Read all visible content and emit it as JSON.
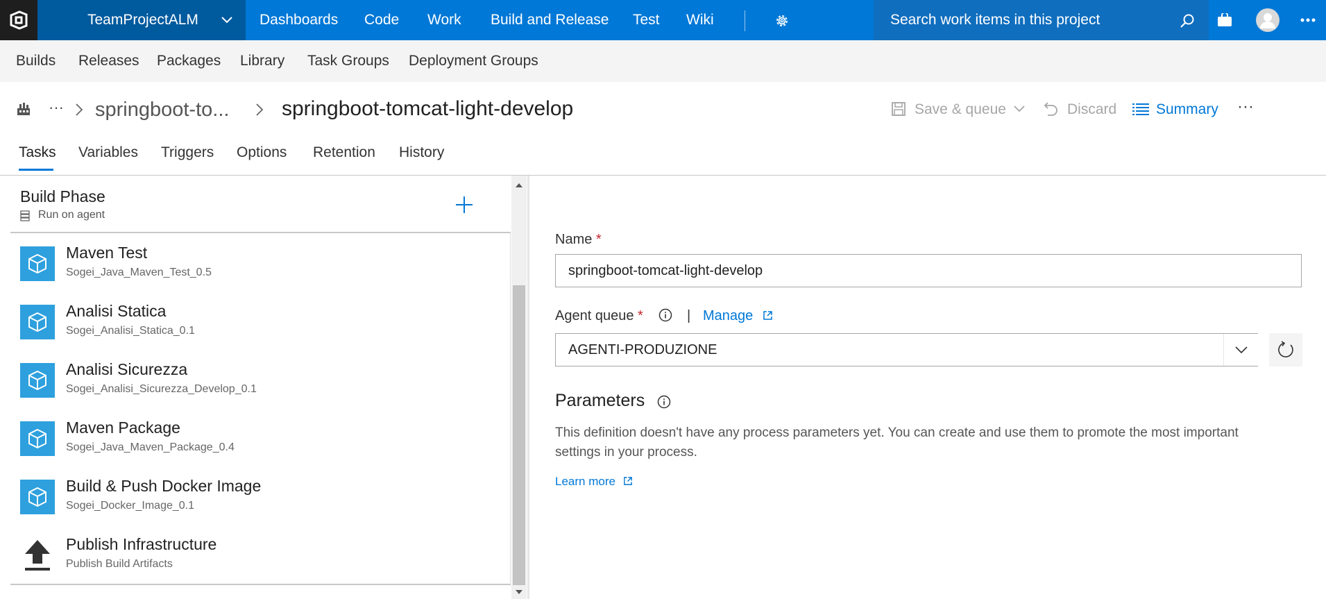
{
  "topbar": {
    "project": "TeamProjectALM",
    "nav": [
      "Dashboards",
      "Code",
      "Work",
      "Build and Release",
      "Test",
      "Wiki"
    ],
    "search_placeholder": "Search work items in this project"
  },
  "subnav": [
    "Builds",
    "Releases",
    "Packages",
    "Library",
    "Task Groups",
    "Deployment Groups"
  ],
  "header": {
    "ellipsis": "···",
    "breadcrumb_parent": "springboot-to...",
    "title": "springboot-tomcat-light-develop",
    "save_queue": "Save & queue",
    "discard": "Discard",
    "summary": "Summary",
    "more": "···"
  },
  "tabs": [
    "Tasks",
    "Variables",
    "Triggers",
    "Options",
    "Retention",
    "History"
  ],
  "phase": {
    "title": "Build Phase",
    "subtitle": "Run on agent"
  },
  "tasks": [
    {
      "name": "Maven Test",
      "sub": "Sogei_Java_Maven_Test_0.5",
      "icon": "cube-icon"
    },
    {
      "name": "Analisi Statica",
      "sub": "Sogei_Analisi_Statica_0.1",
      "icon": "cube-icon"
    },
    {
      "name": "Analisi Sicurezza",
      "sub": "Sogei_Analisi_Sicurezza_Develop_0.1",
      "icon": "cube-icon"
    },
    {
      "name": "Maven Package",
      "sub": "Sogei_Java_Maven_Package_0.4",
      "icon": "cube-icon"
    },
    {
      "name": "Build & Push Docker Image",
      "sub": "Sogei_Docker_Image_0.1",
      "icon": "cube-icon"
    },
    {
      "name": "Publish Infrastructure",
      "sub": "Publish Build Artifacts",
      "icon": "upload-icon"
    }
  ],
  "form": {
    "name_label": "Name",
    "required_mark": "*",
    "name_value": "springboot-tomcat-light-develop",
    "agent_queue_label": "Agent queue",
    "pipe": "|",
    "manage": "Manage",
    "agent_queue_value": "AGENTI-PRODUZIONE",
    "parameters_title": "Parameters",
    "parameters_text": "This definition doesn't have any process parameters yet. You can create and use them to promote the most important settings in your process.",
    "learn_more": "Learn more"
  },
  "colors": {
    "brand_blue": "#0078d7",
    "project_blue": "#005a9e",
    "task_icon": "#2ea0de",
    "required": "#c4262e"
  }
}
